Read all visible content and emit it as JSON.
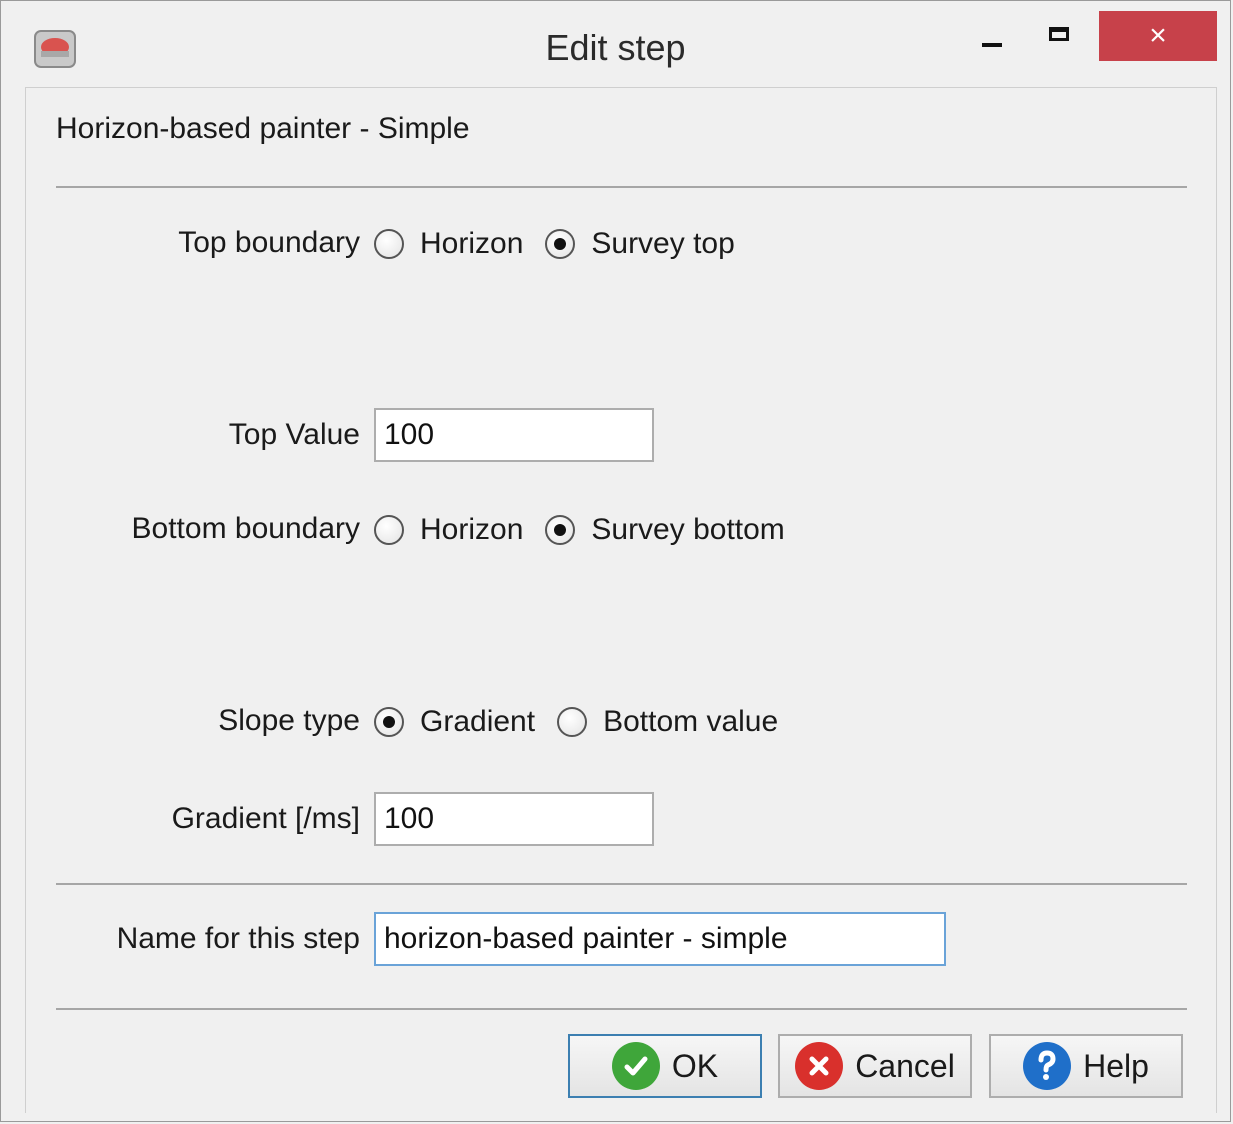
{
  "window": {
    "title": "Edit step",
    "close_glyph": "×"
  },
  "heading": "Horizon-based painter - Simple",
  "top_boundary": {
    "label": "Top boundary",
    "options": [
      {
        "label": "Horizon",
        "checked": false
      },
      {
        "label": "Survey top",
        "checked": true
      }
    ]
  },
  "top_value": {
    "label": "Top Value",
    "value": "100"
  },
  "bottom_boundary": {
    "label": "Bottom boundary",
    "options": [
      {
        "label": "Horizon",
        "checked": false
      },
      {
        "label": "Survey bottom",
        "checked": true
      }
    ]
  },
  "slope_type": {
    "label": "Slope type",
    "options": [
      {
        "label": "Gradient",
        "checked": true
      },
      {
        "label": "Bottom value",
        "checked": false
      }
    ]
  },
  "gradient": {
    "label": "Gradient [/ms]",
    "value": "100"
  },
  "step_name": {
    "label": "Name for this step",
    "value": "horizon-based painter - simple"
  },
  "buttons": {
    "ok": "OK",
    "cancel": "Cancel",
    "help": "Help"
  },
  "icons": {
    "app": "app-logo-icon",
    "ok": "check-icon",
    "cancel": "cancel-x-icon",
    "help": "question-icon"
  },
  "colors": {
    "close_button": "#c7414a",
    "ok_icon": "#3fa63a",
    "cancel_icon": "#d9302c",
    "help_icon": "#1f6fc9"
  }
}
